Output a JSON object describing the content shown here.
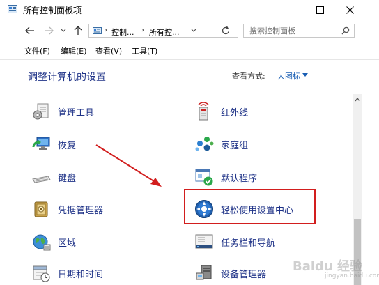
{
  "window": {
    "title": "所有控制面板项"
  },
  "navigation": {
    "breadcrumbs": [
      "控制...",
      "所有控..."
    ],
    "search_placeholder": "搜索控制面板"
  },
  "menu": {
    "items": [
      "文件(F)",
      "编辑(E)",
      "查看(V)",
      "工具(T)"
    ]
  },
  "content": {
    "heading": "调整计算机的设置",
    "view_by_label": "查看方式:",
    "view_by_value": "大图标"
  },
  "items": [
    {
      "label": "管理工具",
      "icon": "admin-tools-icon"
    },
    {
      "label": "红外线",
      "icon": "infrared-icon"
    },
    {
      "label": "恢复",
      "icon": "recovery-icon"
    },
    {
      "label": "家庭组",
      "icon": "homegroup-icon"
    },
    {
      "label": "键盘",
      "icon": "keyboard-icon"
    },
    {
      "label": "默认程序",
      "icon": "default-programs-icon"
    },
    {
      "label": "凭据管理器",
      "icon": "credential-manager-icon"
    },
    {
      "label": "轻松使用设置中心",
      "icon": "ease-of-access-icon"
    },
    {
      "label": "区域",
      "icon": "region-icon"
    },
    {
      "label": "任务栏和导航",
      "icon": "taskbar-icon"
    },
    {
      "label": "日期和时间",
      "icon": "date-time-icon"
    },
    {
      "label": "设备管理器",
      "icon": "device-manager-icon"
    }
  ],
  "annotation": {
    "highlight_color": "#d21e1e"
  },
  "watermark": {
    "text": "Baidu 经验",
    "sub": "jingyan.baidu.com"
  }
}
